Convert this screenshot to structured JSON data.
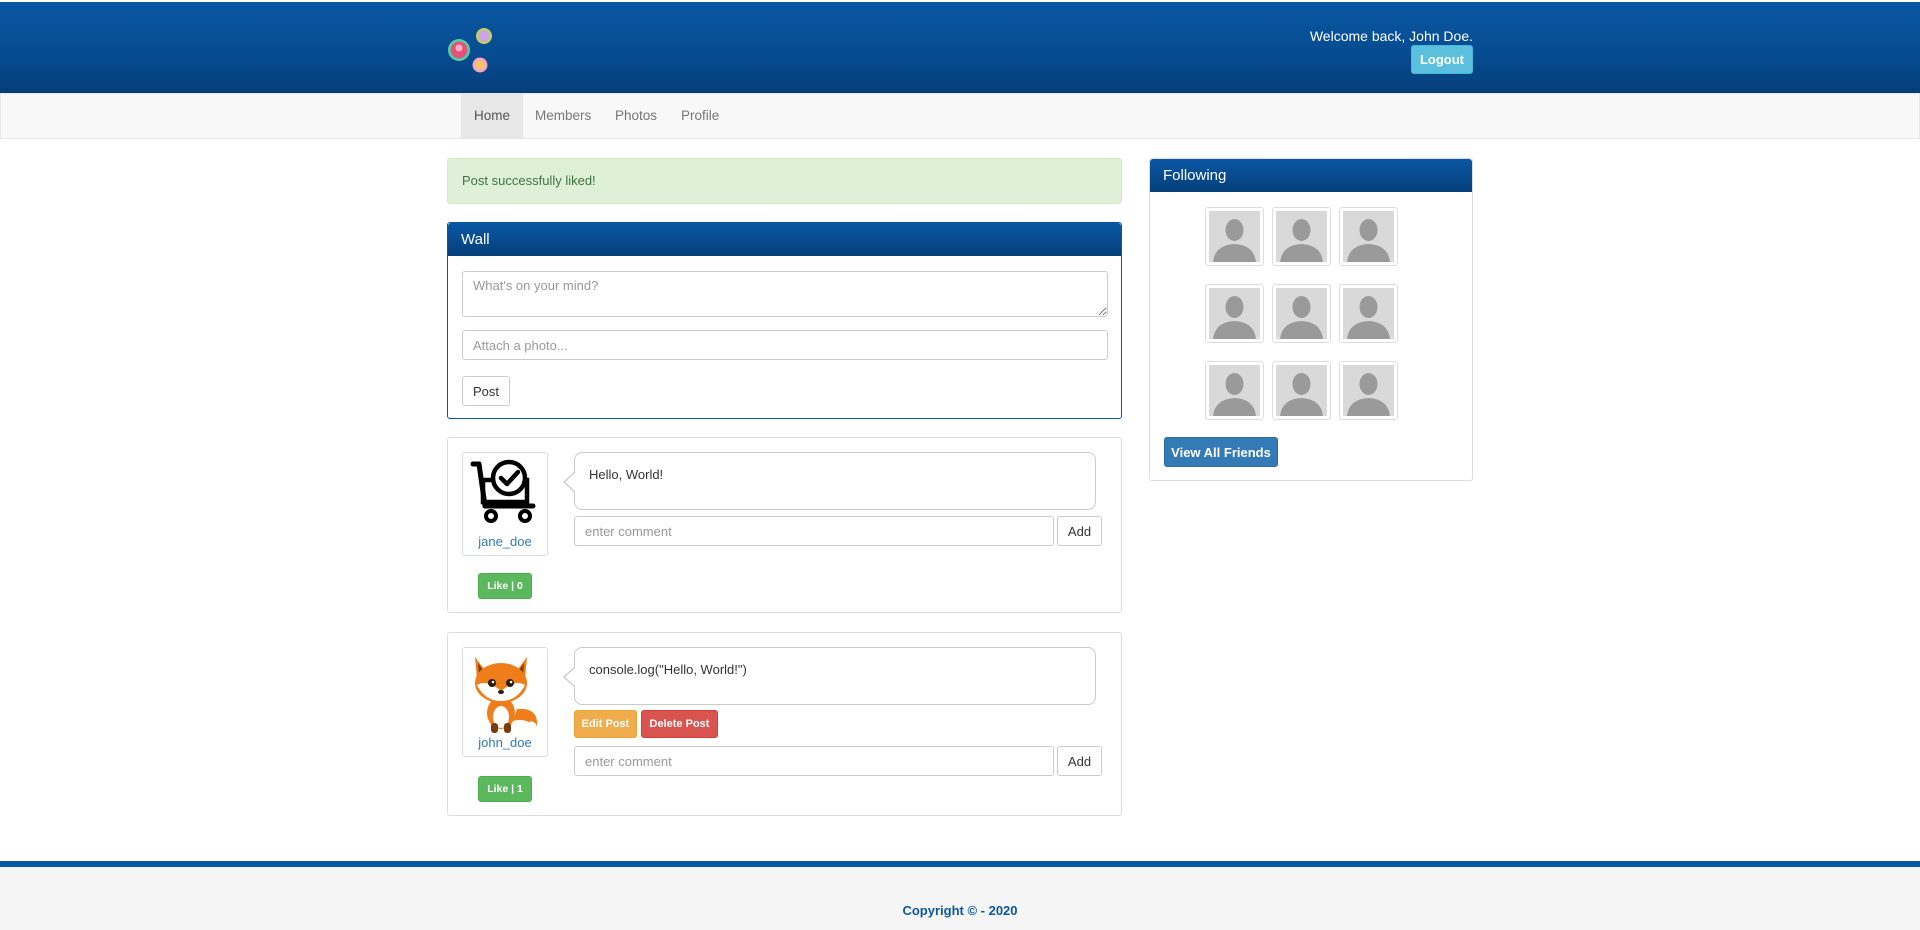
{
  "header": {
    "welcome_text": "Welcome back, John Doe.",
    "logout_label": "Logout"
  },
  "nav": {
    "items": [
      {
        "label": "Home",
        "active": true
      },
      {
        "label": "Members",
        "active": false
      },
      {
        "label": "Photos",
        "active": false
      },
      {
        "label": "Profile",
        "active": false
      }
    ]
  },
  "alert": {
    "message": "Post successfully liked!"
  },
  "wall": {
    "title": "Wall",
    "post_placeholder": "What's on your mind?",
    "photo_placeholder": "Attach a photo...",
    "post_label": "Post"
  },
  "posts": [
    {
      "username": "jane_doe",
      "avatar": "cart-check-icon",
      "content": "Hello, World!",
      "like_label": "Like | 0",
      "comment_placeholder": "enter comment",
      "add_label": "Add"
    },
    {
      "username": "john_doe",
      "avatar": "fox-avatar",
      "content": "console.log(\"Hello, World!\")",
      "edit_label": "Edit Post",
      "delete_label": "Delete Post",
      "like_label": "Like | 1",
      "comment_placeholder": "enter comment",
      "add_label": "Add"
    }
  ],
  "following": {
    "title": "Following",
    "friend_count": 9,
    "view_all_label": "View All Friends"
  },
  "footer": {
    "copyright": "Copyright © - 2020"
  },
  "colors": {
    "brand_blue": "#0a57a4",
    "alert_green_bg": "#dff0d8",
    "like_green": "#5cb85c",
    "edit_orange": "#f0ad4e",
    "delete_red": "#d9534f",
    "logout_cyan": "#5bc0de"
  }
}
